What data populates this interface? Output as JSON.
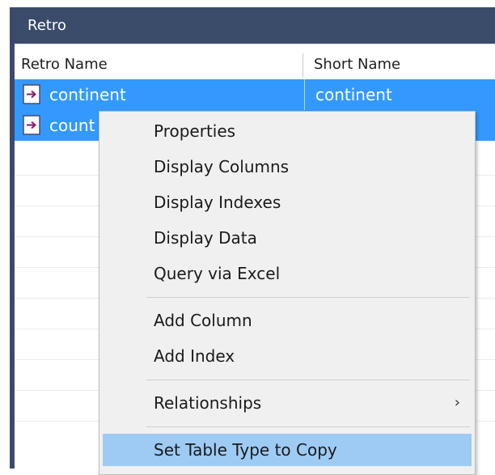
{
  "window": {
    "title": "Retro"
  },
  "columns": [
    "Retro Name",
    "Short Name"
  ],
  "rows": [
    {
      "name": "continent",
      "short": "continent",
      "selected": true
    },
    {
      "name": "count",
      "short": "",
      "selected": true
    }
  ],
  "menu": {
    "items": [
      {
        "label": "Properties"
      },
      {
        "label": "Display Columns"
      },
      {
        "label": "Display Indexes"
      },
      {
        "label": "Display Data"
      },
      {
        "label": "Query via Excel"
      },
      {
        "label": "Add Column"
      },
      {
        "label": "Add Index"
      },
      {
        "label": "Relationships",
        "submenu_arrow": "›"
      },
      {
        "label": "Set Table Type to Copy",
        "highlighted": true
      }
    ]
  },
  "colors": {
    "titlebar": "#3b4b6a",
    "selection": "#3399ff",
    "menu_highlight": "#9ecbf3"
  },
  "icons": {
    "row_icon": "table-arrow-icon"
  }
}
